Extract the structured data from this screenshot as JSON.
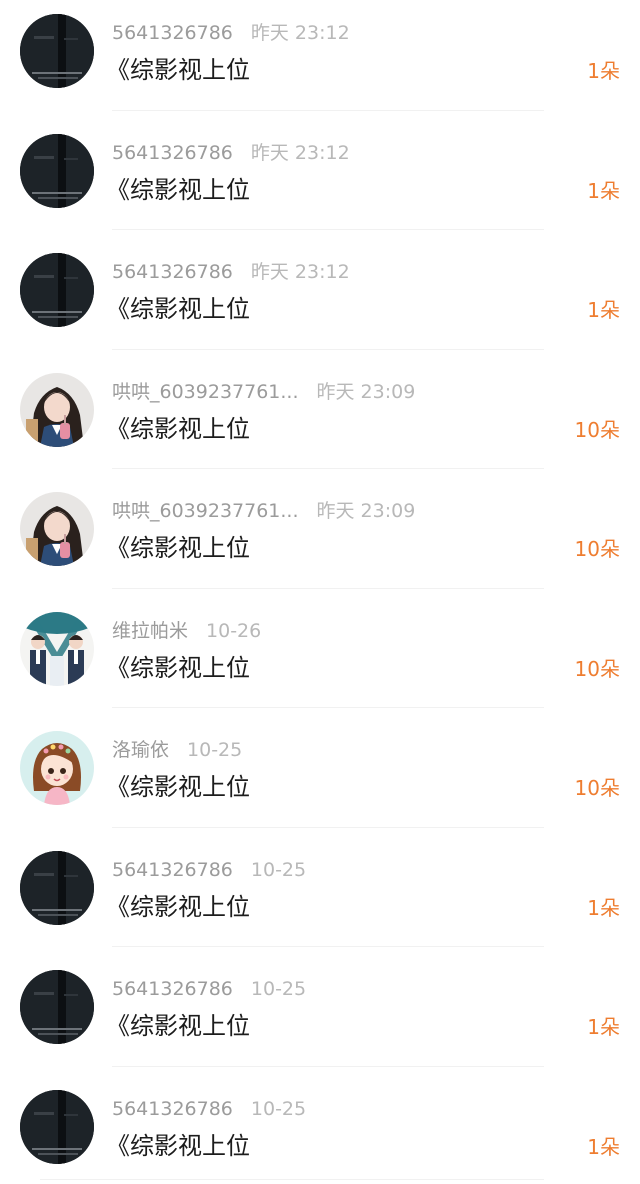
{
  "rows": [
    {
      "avatar": "dark-photo-avatar",
      "username": "5641326786",
      "time": "昨天 23:12",
      "title": "《综影视上位",
      "count": "1朵"
    },
    {
      "avatar": "dark-photo-avatar",
      "username": "5641326786",
      "time": "昨天 23:12",
      "title": "《综影视上位",
      "count": "1朵"
    },
    {
      "avatar": "dark-photo-avatar",
      "username": "5641326786",
      "time": "昨天 23:12",
      "title": "《综影视上位",
      "count": "1朵"
    },
    {
      "avatar": "girl-photo-avatar",
      "username": "哄哄_6039237761...",
      "time": "昨天 23:09",
      "title": "《综影视上位",
      "count": "10朵"
    },
    {
      "avatar": "girl-photo-avatar",
      "username": "哄哄_6039237761...",
      "time": "昨天 23:09",
      "title": "《综影视上位",
      "count": "10朵"
    },
    {
      "avatar": "students-photo-avatar",
      "username": "维拉帕米",
      "time": "10-26",
      "title": "《综影视上位",
      "count": "10朵"
    },
    {
      "avatar": "cartoon-girl-avatar",
      "username": "洛瑜依",
      "time": "10-25",
      "title": "《综影视上位",
      "count": "10朵"
    },
    {
      "avatar": "dark-photo-avatar",
      "username": "5641326786",
      "time": "10-25",
      "title": "《综影视上位",
      "count": "1朵"
    },
    {
      "avatar": "dark-photo-avatar",
      "username": "5641326786",
      "time": "10-25",
      "title": "《综影视上位",
      "count": "1朵"
    },
    {
      "avatar": "dark-photo-avatar",
      "username": "5641326786",
      "time": "10-25",
      "title": "《综影视上位",
      "count": "1朵"
    }
  ]
}
